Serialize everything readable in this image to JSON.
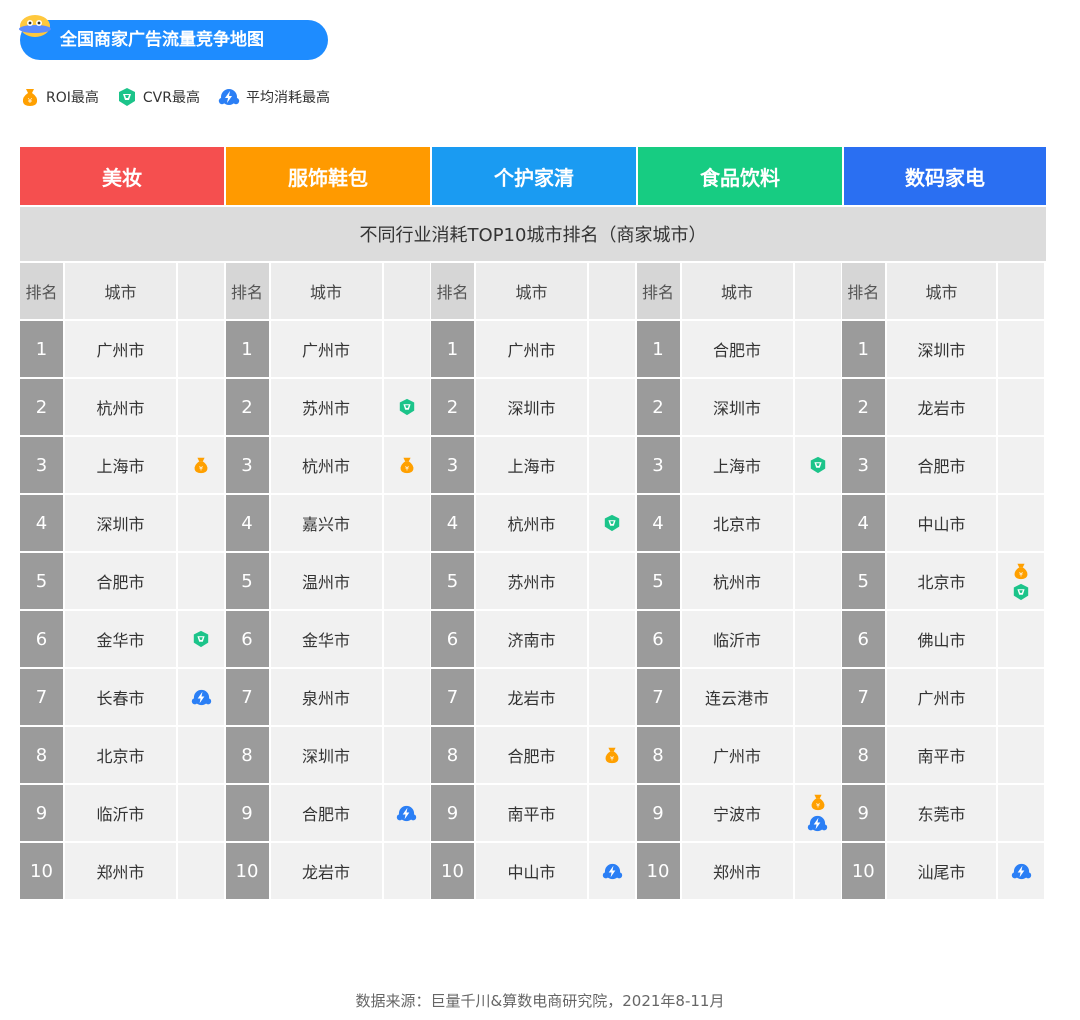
{
  "title": "全国商家广告流量竞争地图",
  "legend": [
    {
      "key": "roi",
      "label": "ROI最高",
      "icon": "money-bag-icon",
      "color": "#ffa000"
    },
    {
      "key": "cvr",
      "label": "CVR最高",
      "icon": "shield-gem-icon",
      "color": "#1cc48a"
    },
    {
      "key": "avg",
      "label": "平均消耗最高",
      "icon": "lightning-cloud-icon",
      "color": "#2b7ff5"
    }
  ],
  "categories": [
    {
      "name": "美妆",
      "color": "#f54f4f"
    },
    {
      "name": "服饰鞋包",
      "color": "#ff9a00"
    },
    {
      "name": "个护家清",
      "color": "#1a9bf2"
    },
    {
      "name": "食品饮料",
      "color": "#17cc82"
    },
    {
      "name": "数码家电",
      "color": "#2a6ff2"
    }
  ],
  "subtitle": "不同行业消耗TOP10城市排名（商家城市）",
  "column_headers": {
    "rank": "排名",
    "city": "城市"
  },
  "tables": [
    {
      "rows": [
        {
          "rank": "1",
          "city": "广州市",
          "icons": []
        },
        {
          "rank": "2",
          "city": "杭州市",
          "icons": []
        },
        {
          "rank": "3",
          "city": "上海市",
          "icons": [
            "roi"
          ]
        },
        {
          "rank": "4",
          "city": "深圳市",
          "icons": []
        },
        {
          "rank": "5",
          "city": "合肥市",
          "icons": []
        },
        {
          "rank": "6",
          "city": "金华市",
          "icons": [
            "cvr"
          ]
        },
        {
          "rank": "7",
          "city": "长春市",
          "icons": [
            "avg"
          ]
        },
        {
          "rank": "8",
          "city": "北京市",
          "icons": []
        },
        {
          "rank": "9",
          "city": "临沂市",
          "icons": []
        },
        {
          "rank": "10",
          "city": "郑州市",
          "icons": []
        }
      ]
    },
    {
      "rows": [
        {
          "rank": "1",
          "city": "广州市",
          "icons": []
        },
        {
          "rank": "2",
          "city": "苏州市",
          "icons": [
            "cvr"
          ]
        },
        {
          "rank": "3",
          "city": "杭州市",
          "icons": [
            "roi"
          ]
        },
        {
          "rank": "4",
          "city": "嘉兴市",
          "icons": []
        },
        {
          "rank": "5",
          "city": "温州市",
          "icons": []
        },
        {
          "rank": "6",
          "city": "金华市",
          "icons": []
        },
        {
          "rank": "7",
          "city": "泉州市",
          "icons": []
        },
        {
          "rank": "8",
          "city": "深圳市",
          "icons": []
        },
        {
          "rank": "9",
          "city": "合肥市",
          "icons": [
            "avg"
          ]
        },
        {
          "rank": "10",
          "city": "龙岩市",
          "icons": []
        }
      ]
    },
    {
      "rows": [
        {
          "rank": "1",
          "city": "广州市",
          "icons": []
        },
        {
          "rank": "2",
          "city": "深圳市",
          "icons": []
        },
        {
          "rank": "3",
          "city": "上海市",
          "icons": []
        },
        {
          "rank": "4",
          "city": "杭州市",
          "icons": [
            "cvr"
          ]
        },
        {
          "rank": "5",
          "city": "苏州市",
          "icons": []
        },
        {
          "rank": "6",
          "city": "济南市",
          "icons": []
        },
        {
          "rank": "7",
          "city": "龙岩市",
          "icons": []
        },
        {
          "rank": "8",
          "city": "合肥市",
          "icons": [
            "roi"
          ]
        },
        {
          "rank": "9",
          "city": "南平市",
          "icons": []
        },
        {
          "rank": "10",
          "city": "中山市",
          "icons": [
            "avg"
          ]
        }
      ]
    },
    {
      "rows": [
        {
          "rank": "1",
          "city": "合肥市",
          "icons": []
        },
        {
          "rank": "2",
          "city": "深圳市",
          "icons": []
        },
        {
          "rank": "3",
          "city": "上海市",
          "icons": [
            "cvr"
          ]
        },
        {
          "rank": "4",
          "city": "北京市",
          "icons": []
        },
        {
          "rank": "5",
          "city": "杭州市",
          "icons": []
        },
        {
          "rank": "6",
          "city": "临沂市",
          "icons": []
        },
        {
          "rank": "7",
          "city": "连云港市",
          "icons": []
        },
        {
          "rank": "8",
          "city": "广州市",
          "icons": []
        },
        {
          "rank": "9",
          "city": "宁波市",
          "icons": [
            "roi",
            "avg"
          ]
        },
        {
          "rank": "10",
          "city": "郑州市",
          "icons": []
        }
      ]
    },
    {
      "rows": [
        {
          "rank": "1",
          "city": "深圳市",
          "icons": []
        },
        {
          "rank": "2",
          "city": "龙岩市",
          "icons": []
        },
        {
          "rank": "3",
          "city": "合肥市",
          "icons": []
        },
        {
          "rank": "4",
          "city": "中山市",
          "icons": []
        },
        {
          "rank": "5",
          "city": "北京市",
          "icons": [
            "roi",
            "cvr"
          ]
        },
        {
          "rank": "6",
          "city": "佛山市",
          "icons": []
        },
        {
          "rank": "7",
          "city": "广州市",
          "icons": []
        },
        {
          "rank": "8",
          "city": "南平市",
          "icons": []
        },
        {
          "rank": "9",
          "city": "东莞市",
          "icons": []
        },
        {
          "rank": "10",
          "city": "汕尾市",
          "icons": [
            "avg"
          ]
        }
      ]
    }
  ],
  "source": "数据来源：巨量千川&算数电商研究院，2021年8-11月"
}
